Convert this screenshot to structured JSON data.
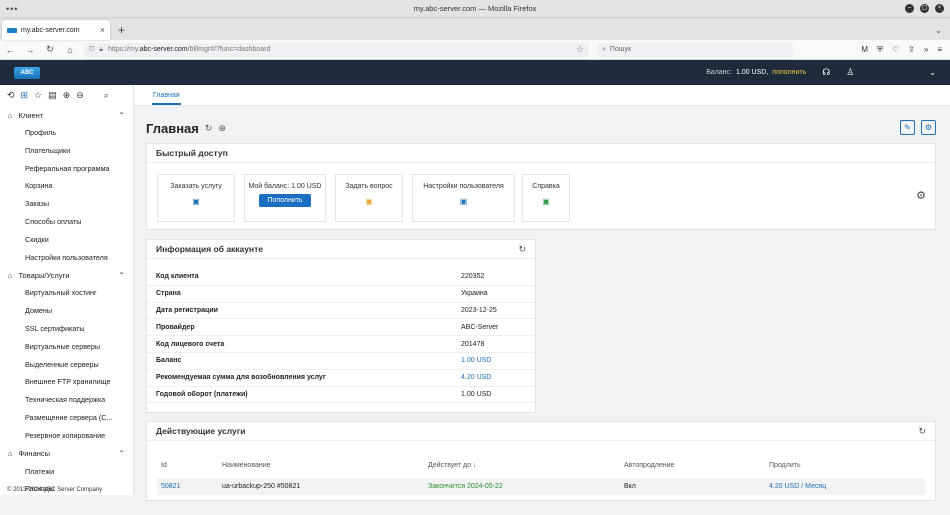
{
  "browser": {
    "window_title": "my.abc-server.com — Mozilla Firefox",
    "tab_title": "my.abc-server.com",
    "url_prefix": "https://my.",
    "url_domain": "abc-server.com",
    "url_path": "/billmgr#/?func=dashboard",
    "search_placeholder": "Пошук"
  },
  "header": {
    "logo_text": "ABC",
    "balance_label": "Баланс:",
    "balance_value": "1.00 USD,",
    "topup_link": "пополнить"
  },
  "sidebar": {
    "groups": [
      {
        "label": "Клиент",
        "items": [
          "Профиль",
          "Плательщики",
          "Реферальная программа",
          "Корзина",
          "Заказы",
          "Способы оплаты",
          "Скидки",
          "Настройки пользователя"
        ]
      },
      {
        "label": "Товары/Услуги",
        "items": [
          "Виртуальный хостинг",
          "Домены",
          "SSL сертификаты",
          "Виртуальные серверы",
          "Выделенные серверы",
          "Внешнее FTP хранилище",
          "Техническая поддержка",
          "Размещение сервера (С...",
          "Резервное копирование"
        ]
      },
      {
        "label": "Финансы",
        "items": [
          "Платежи",
          "Расходы"
        ]
      }
    ],
    "copyright": "© 2013-2024 ABC Server Company"
  },
  "main": {
    "tab": "Главная",
    "page_title": "Главная",
    "quick": {
      "title": "Быстрый доступ",
      "items": [
        {
          "label": "Заказать услугу",
          "icon": "clipboard-icon",
          "color": "#1e6fb5"
        },
        {
          "label": "Мой баланс: 1.00 USD",
          "button": "Пополнить"
        },
        {
          "label": "Задать вопрос",
          "icon": "chat-icon",
          "color": "#e8a33c"
        },
        {
          "label": "Настройки пользователя",
          "icon": "settings-card-icon",
          "color": "#1e6fb5"
        },
        {
          "label": "Справка",
          "icon": "help-doc-icon",
          "color": "#2e9a4a"
        }
      ]
    },
    "account": {
      "title": "Информация об аккаунте",
      "rows": [
        {
          "k": "Код клиента",
          "v": "220352"
        },
        {
          "k": "Страна",
          "v": "Украина"
        },
        {
          "k": "Дата регистрации",
          "v": "2023-12-25"
        },
        {
          "k": "Провайдер",
          "v": "ABC-Server"
        },
        {
          "k": "Код лицевого счета",
          "v": "201478"
        },
        {
          "k": "Баланс",
          "v": "1.00 USD",
          "link": true
        },
        {
          "k": "Рекомендуемая сумма для возобновления услуг",
          "v": "4.20 USD",
          "link": true
        },
        {
          "k": "Годовой оборот (платежи)",
          "v": "1.00 USD"
        }
      ]
    },
    "services": {
      "title": "Действующие услуги",
      "columns": [
        "Id",
        "Наименование",
        "Действует до ↓",
        "Автопродление",
        "Продлить"
      ],
      "rows": [
        {
          "id": "50821",
          "name": "ua-urbackup-250 #50821",
          "until": "Закончится 2024-05-22",
          "auto": "Вкл",
          "renew": "4.20 USD / Месяц"
        }
      ]
    }
  }
}
